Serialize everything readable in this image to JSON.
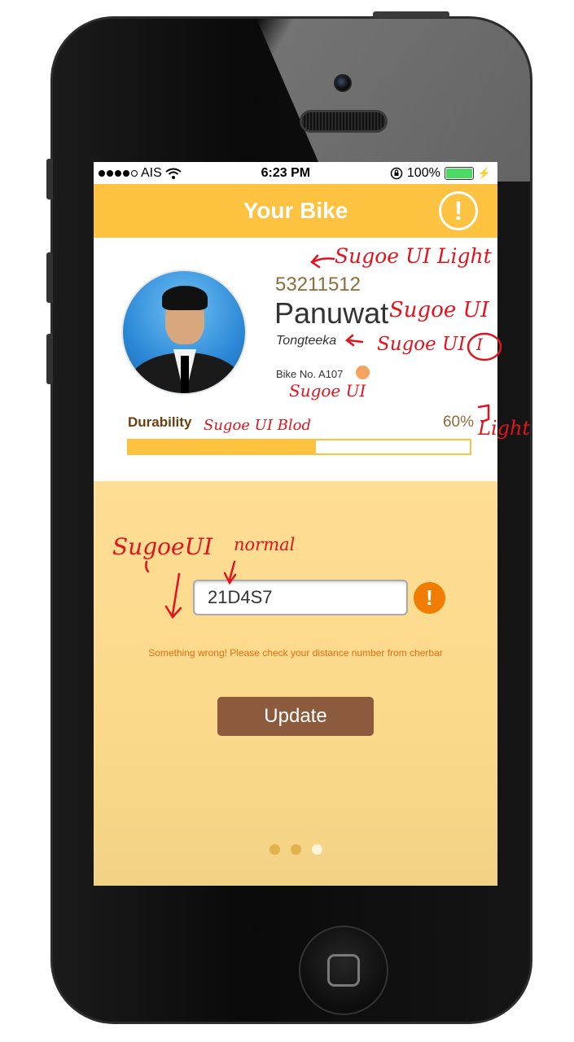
{
  "status_bar": {
    "carrier": "AIS",
    "time": "6:23 PM",
    "battery": "100%"
  },
  "header": {
    "title": "Your Bike",
    "alert_icon": "!"
  },
  "profile": {
    "id": "53211512",
    "first_name": "Panuwat",
    "last_name": "Tongteeka",
    "bike_no": "Bike No. A107"
  },
  "durability": {
    "label": "Durability",
    "percent_text": "60%",
    "value": 0.55
  },
  "form": {
    "code_value": "21D4S7",
    "warning_icon": "!",
    "error_message": "Something wrong! Please check your distance number from cherbar",
    "update_label": "Update"
  },
  "pager": {
    "count": 3,
    "active_index": 2
  },
  "annotations": {
    "id_font": "Sugoe UI Light",
    "name_font": "Sugoe UI",
    "last_font": "Sugoe UI",
    "last_style": "I",
    "bike_font": "Sugoe UI",
    "dur_font": "Sugoe UI Blod",
    "pct_font": "Light",
    "input_font": "SugoeUI",
    "input_weight": "normal"
  },
  "colors": {
    "accent": "#fcc240",
    "button": "#8c5a3c",
    "warning": "#f07c00",
    "annotation": "#e0141e"
  }
}
